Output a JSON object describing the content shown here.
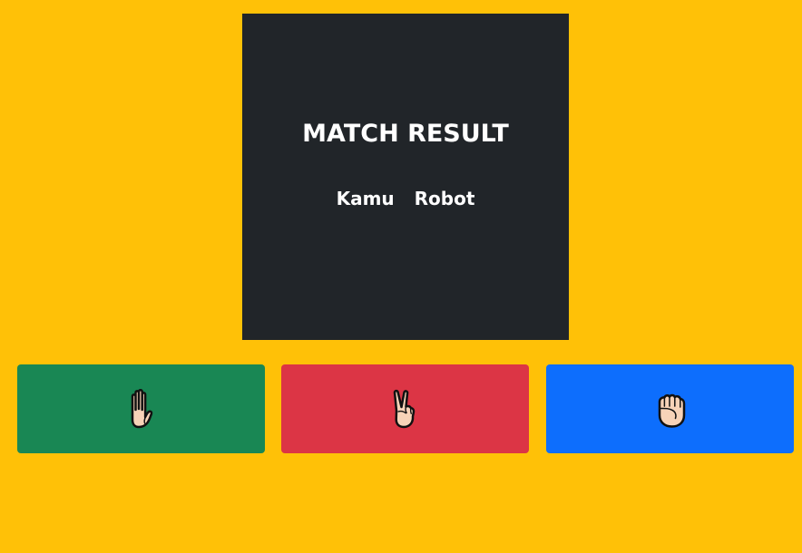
{
  "result": {
    "title": "MATCH RESULT",
    "player_label": "Kamu",
    "opponent_label": "Robot"
  },
  "choices": [
    {
      "name": "paper",
      "icon": "raised-hand-icon",
      "color": "#198754"
    },
    {
      "name": "scissors",
      "icon": "victory-hand-icon",
      "color": "#dc3545"
    },
    {
      "name": "rock",
      "icon": "fist-icon",
      "color": "#0d6efd"
    }
  ],
  "colors": {
    "background": "#ffc107",
    "panel": "#212529",
    "text": "#ffffff",
    "skin": "#f7d3b8"
  }
}
